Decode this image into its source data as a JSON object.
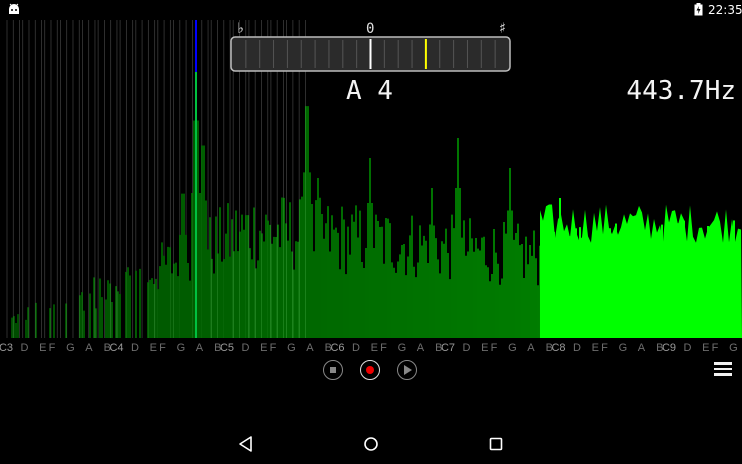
{
  "status_bar": {
    "time": "22:35",
    "left_icon": "android-debug-icon",
    "right_icon": "battery-charging-icon"
  },
  "tuner": {
    "flat_symbol": "♭",
    "zero_label": "0",
    "sharp_symbol": "♯",
    "note": "A 4",
    "frequency": "443.7Hz",
    "needle_offset_fraction": 0.2
  },
  "axis": {
    "labels": [
      "C3",
      "D",
      "E",
      "F",
      "G",
      "A",
      "B",
      "C4",
      "D",
      "E",
      "F",
      "G",
      "A",
      "B",
      "C5",
      "D",
      "E",
      "F",
      "G",
      "A",
      "B",
      "C6",
      "D",
      "E",
      "F",
      "G",
      "A",
      "B",
      "C7",
      "D",
      "E",
      "F",
      "G",
      "A",
      "B",
      "C8",
      "D",
      "E",
      "F",
      "G",
      "A",
      "B",
      "C9",
      "D",
      "E",
      "F",
      "G"
    ]
  },
  "controls": {
    "stop_icon": "stop-icon",
    "record_icon": "record-icon",
    "play_icon": "play-icon",
    "menu_icon": "hamburger-menu-icon"
  },
  "nav_bar": {
    "back_icon": "back-triangle-icon",
    "home_icon": "home-circle-icon",
    "recents_icon": "recents-square-icon"
  },
  "colors": {
    "spectrum": "#00ff00",
    "highlight_line": "#0000ff",
    "needle": "#ffff00",
    "record": "#ff0000"
  }
}
